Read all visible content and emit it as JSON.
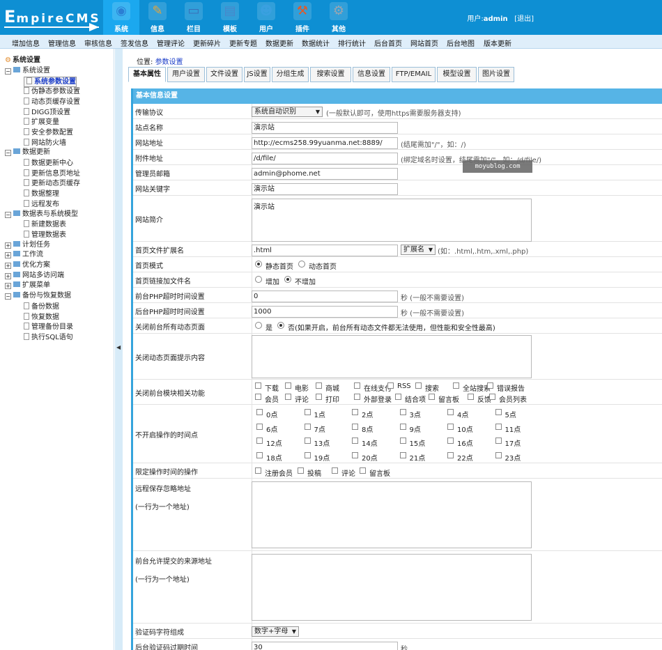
{
  "brand": {
    "logo_big": "E",
    "logo_rest": "mpireCMS"
  },
  "top_nav": [
    {
      "label": "系统",
      "icon": "globe-icon",
      "glyph": "◉",
      "color": "#2b7fd4",
      "active": true
    },
    {
      "label": "信息",
      "icon": "notepad-icon",
      "glyph": "✎",
      "color": "#e7a43a",
      "active": false
    },
    {
      "label": "栏目",
      "icon": "folder-icon",
      "glyph": "▭",
      "color": "#3a6fb8",
      "active": false
    },
    {
      "label": "模板",
      "icon": "window-icon",
      "glyph": "▤",
      "color": "#4a86c9",
      "active": false
    },
    {
      "label": "用户",
      "icon": "user-icon",
      "glyph": "☻",
      "color": "#3aa0e0",
      "active": false
    },
    {
      "label": "插件",
      "icon": "tools-icon",
      "glyph": "⚒",
      "color": "#e15a2a",
      "active": false
    },
    {
      "label": "其他",
      "icon": "gear-icon",
      "glyph": "⚙",
      "color": "#9aa5b0",
      "active": false
    }
  ],
  "user": {
    "prefix": "用户:",
    "name": "admin",
    "logout": "[退出]"
  },
  "menu": [
    "增加信息",
    "管理信息",
    "审核信息",
    "签发信息",
    "管理评论",
    "更新碎片",
    "更新专题",
    "数据更新",
    "数据统计",
    "排行统计",
    "后台首页",
    "网站首页",
    "后台地图",
    "版本更新"
  ],
  "tree": [
    {
      "t": "系统设置",
      "lvl": 0,
      "kind": "root"
    },
    {
      "t": "系统设置",
      "lvl": 1,
      "kind": "folder",
      "box": "−"
    },
    {
      "t": "系统参数设置",
      "lvl": 2,
      "kind": "doc",
      "sel": true
    },
    {
      "t": "伪静态参数设置",
      "lvl": 2,
      "kind": "doc"
    },
    {
      "t": "动态页缓存设置",
      "lvl": 2,
      "kind": "doc"
    },
    {
      "t": "DIGG顶设置",
      "lvl": 2,
      "kind": "doc"
    },
    {
      "t": "扩展变量",
      "lvl": 2,
      "kind": "doc"
    },
    {
      "t": "安全参数配置",
      "lvl": 2,
      "kind": "doc"
    },
    {
      "t": "网站防火墙",
      "lvl": 2,
      "kind": "doc"
    },
    {
      "t": "数据更新",
      "lvl": 1,
      "kind": "folder",
      "box": "−"
    },
    {
      "t": "数据更新中心",
      "lvl": 2,
      "kind": "doc"
    },
    {
      "t": "更新信息页地址",
      "lvl": 2,
      "kind": "doc"
    },
    {
      "t": "更新动态页缓存",
      "lvl": 2,
      "kind": "doc"
    },
    {
      "t": "数据整理",
      "lvl": 2,
      "kind": "doc"
    },
    {
      "t": "远程发布",
      "lvl": 2,
      "kind": "doc"
    },
    {
      "t": "数据表与系统模型",
      "lvl": 1,
      "kind": "folder",
      "box": "−"
    },
    {
      "t": "新建数据表",
      "lvl": 2,
      "kind": "doc"
    },
    {
      "t": "管理数据表",
      "lvl": 2,
      "kind": "doc"
    },
    {
      "t": "计划任务",
      "lvl": 1,
      "kind": "folder",
      "box": "+"
    },
    {
      "t": "工作流",
      "lvl": 1,
      "kind": "folder",
      "box": "+"
    },
    {
      "t": "优化方案",
      "lvl": 1,
      "kind": "folder",
      "box": "+"
    },
    {
      "t": "网站多访问端",
      "lvl": 1,
      "kind": "folder",
      "box": "+"
    },
    {
      "t": "扩展菜单",
      "lvl": 1,
      "kind": "folder",
      "box": "+"
    },
    {
      "t": "备份与恢复数据",
      "lvl": 1,
      "kind": "folder",
      "box": "−"
    },
    {
      "t": "备份数据",
      "lvl": 2,
      "kind": "doc"
    },
    {
      "t": "恢复数据",
      "lvl": 2,
      "kind": "doc"
    },
    {
      "t": "管理备份目录",
      "lvl": 2,
      "kind": "doc"
    },
    {
      "t": "执行SQL语句",
      "lvl": 2,
      "kind": "doc"
    }
  ],
  "location": {
    "prefix": "位置:",
    "link": "参数设置"
  },
  "tabs": [
    "基本属性",
    "用户设置",
    "文件设置",
    "JS设置",
    "分组生成",
    "搜索设置",
    "信息设置",
    "FTP/EMAIL",
    "模型设置",
    "图片设置"
  ],
  "form": {
    "header": "基本信息设置",
    "protocol": {
      "label": "传输协议",
      "value": "系统自动识别",
      "hint": "(一般默认即可，使用https需要服务器支持)"
    },
    "site_name": {
      "label": "站点名称",
      "value": "演示站"
    },
    "site_url": {
      "label": "网站地址",
      "value": "http://ecms258.99yuanma.net:8889/",
      "hint": "(结尾需加\"/\"，如：/)"
    },
    "attach_url": {
      "label": "附件地址",
      "value": "/d/file/",
      "hint": "(绑定域名时设置，结尾需加\"/\"，如：/d/file/)"
    },
    "admin_email": {
      "label": "管理员邮箱",
      "value": "admin@phome.net"
    },
    "keywords": {
      "label": "网站关键字",
      "value": "演示站"
    },
    "intro": {
      "label": "网站简介",
      "value": "演示站"
    },
    "index_ext": {
      "label": "首页文件扩展名",
      "value": ".html",
      "select": "扩展名",
      "hint": "(如：.html,.htm,.xml,.php)"
    },
    "index_mode": {
      "label": "首页模式",
      "opt1": "静态首页",
      "opt2": "动态首页"
    },
    "index_link": {
      "label": "首页链接加文件名",
      "opt1": "增加",
      "opt2": "不增加"
    },
    "front_timeout": {
      "label": "前台PHP超时时间设置",
      "value": "0",
      "hint": "秒 (一般不需要设置)"
    },
    "back_timeout": {
      "label": "后台PHP超时时间设置",
      "value": "1000",
      "hint": "秒 (一般不需要设置)"
    },
    "close_dynamic": {
      "label": "关闭前台所有动态页面",
      "opt1": "是",
      "opt2": "否(如果开启，前台所有动态文件都无法使用，但性能和安全性最高)"
    },
    "close_tip": {
      "label": "关闭动态页面提示内容"
    },
    "close_modules": {
      "label": "关闭前台模块相关功能",
      "row1": [
        "下载",
        "电影",
        "商城",
        "在线支付",
        "RSS",
        "搜索",
        "全站搜索",
        "错误报告"
      ],
      "row2": [
        "会员",
        "评论",
        "打印",
        "外部登录",
        "结合项",
        "留言板",
        "反馈",
        "会员列表"
      ]
    },
    "no_op_hours": {
      "label": "不开启操作的时间点",
      "hours": [
        "0点",
        "1点",
        "2点",
        "3点",
        "4点",
        "5点",
        "6点",
        "7点",
        "8点",
        "9点",
        "10点",
        "11点",
        "12点",
        "13点",
        "14点",
        "15点",
        "16点",
        "17点",
        "18点",
        "19点",
        "20点",
        "21点",
        "22点",
        "23点"
      ]
    },
    "limit_ops": {
      "label": "限定操作时间的操作",
      "opts": [
        "注册会员",
        "投稿",
        "评论",
        "留言板"
      ]
    },
    "remote_ignore": {
      "label": "远程保存忽略地址",
      "sub": "(一行为一个地址)"
    },
    "allowed_src": {
      "label": "前台允许提交的来源地址",
      "sub": "(一行为一个地址)"
    },
    "captcha": {
      "label": "验证码字符组成",
      "value": "数字+字母"
    },
    "last_row": {
      "label": "后台验证码过期时间",
      "value": "30",
      "hint": "秒"
    }
  },
  "watermark": "moyublog.com"
}
